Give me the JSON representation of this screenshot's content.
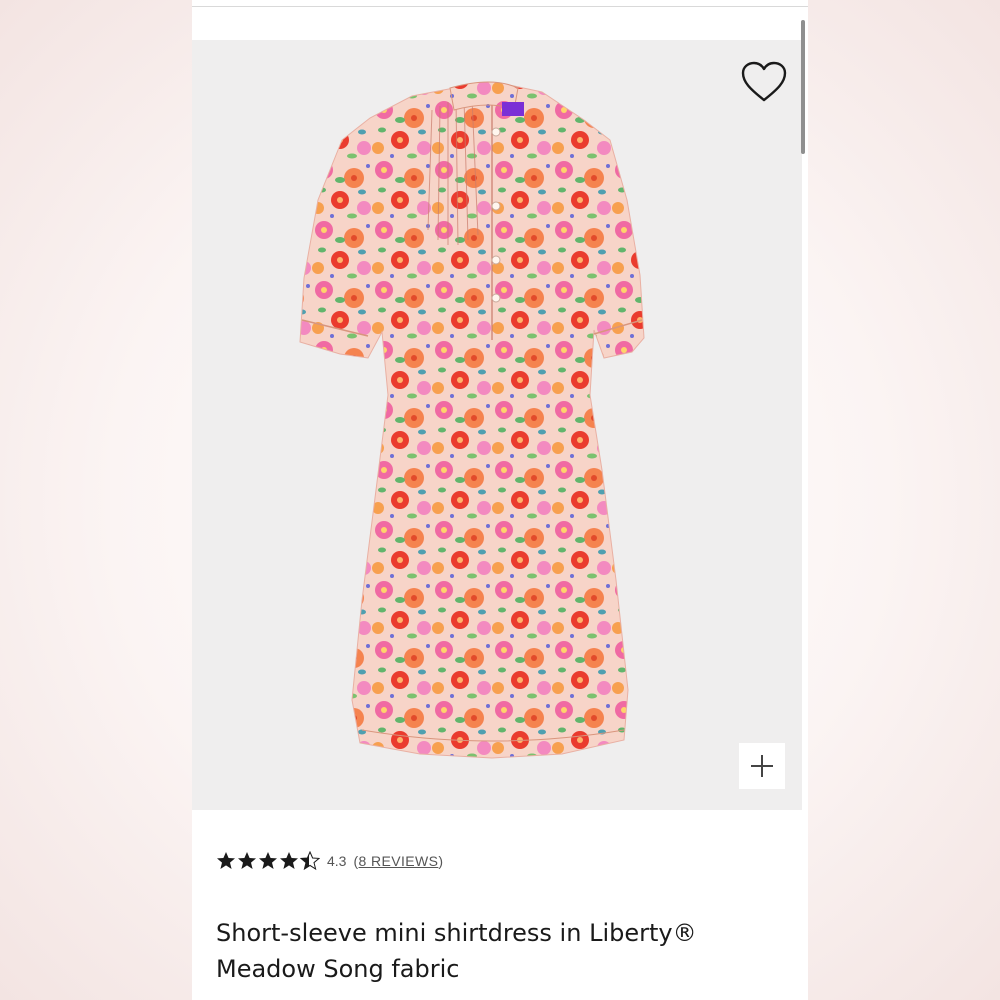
{
  "product": {
    "title": "Short-sleeve mini shirtdress in Liberty® Meadow Song fabric",
    "rating_value": "4.3",
    "rating_stars": 4.3,
    "reviews_label": "8 REVIEWS",
    "image_alt": "Short-sleeve mini shirtdress in Liberty® Meadow Song fabric"
  },
  "icons": {
    "favorite": "heart-outline-icon",
    "zoom": "plus-icon"
  },
  "colors": {
    "background": "#efeeee",
    "text": "#1a1a1a",
    "star": "#1a1a1a",
    "print_pink": "#f06aa3",
    "print_orange": "#f5834f",
    "print_red": "#ea3b2e",
    "print_green": "#62b56c",
    "print_base": "#f7d4c8"
  }
}
